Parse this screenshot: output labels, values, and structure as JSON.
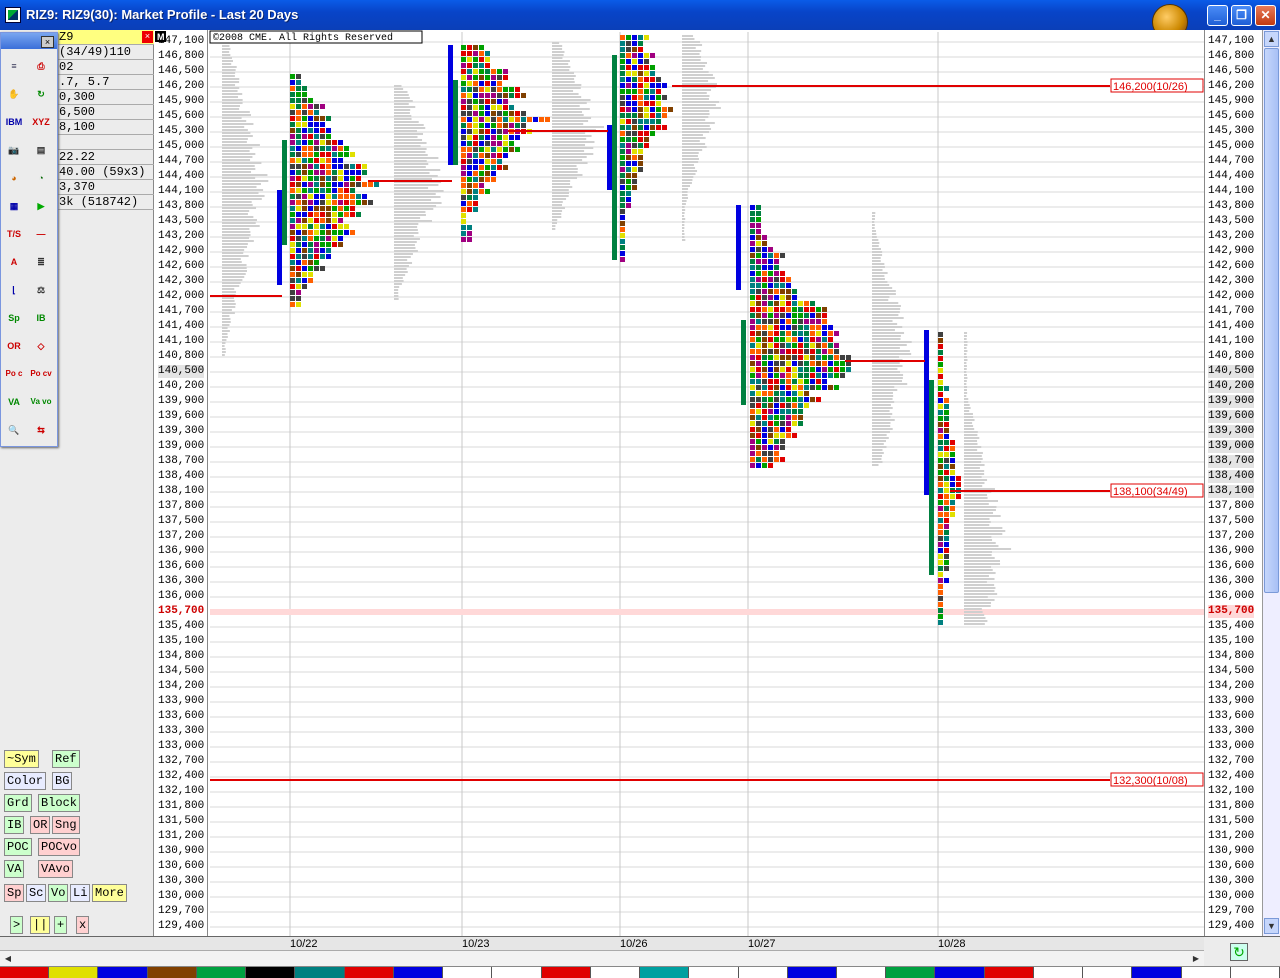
{
  "window": {
    "title": "RIZ9: RIZ9(30): Market Profile - Last 20 Days",
    "buttons": [
      "minimize",
      "maximize",
      "close"
    ]
  },
  "chart": {
    "copyright": "©2008 CME. All Rights Reserved",
    "marker_m": "M",
    "y_axis": {
      "step": 300,
      "max": 147100,
      "min": 129400,
      "labels": [
        "147,100",
        "146,800",
        "146,500",
        "146,200",
        "145,900",
        "145,600",
        "145,300",
        "145,000",
        "144,700",
        "144,400",
        "144,100",
        "143,800",
        "143,500",
        "143,200",
        "142,900",
        "142,600",
        "142,300",
        "142,000",
        "141,700",
        "141,400",
        "141,100",
        "140,800",
        "140,500",
        "140,200",
        "139,900",
        "139,600",
        "139,300",
        "139,000",
        "138,700",
        "138,400",
        "138,100",
        "137,800",
        "137,500",
        "137,200",
        "136,900",
        "136,600",
        "136,300",
        "136,000",
        "135,700",
        "135,400",
        "135,100",
        "134,800",
        "134,500",
        "134,200",
        "133,900",
        "133,600",
        "133,300",
        "133,000",
        "132,700",
        "132,400",
        "132,100",
        "131,800",
        "131,500",
        "131,200",
        "130,900",
        "130,600",
        "130,300",
        "130,000",
        "129,700",
        "129,400"
      ],
      "current_price": "135,700"
    },
    "x_axis": [
      "10/22",
      "10/23",
      "10/26",
      "10/27",
      "10/28"
    ],
    "level_lines": [
      {
        "label": "146,200(10/26)",
        "color": "#e00000"
      },
      {
        "label": "138,100(34/49)",
        "color": "#e00000"
      },
      {
        "label": "132,300(10/08)",
        "color": "#e00000"
      }
    ],
    "tpo_colors": [
      "#e00000",
      "#0000e0",
      "#e0e000",
      "#008040",
      "#804000",
      "#a00080",
      "#008080",
      "#ff6000",
      "#404040",
      "#00a000"
    ]
  },
  "info_panel": {
    "symbol": "Z9",
    "rows": [
      "(34/49)110",
      "02",
      ".7, 5.7",
      "0,300",
      "6,500",
      "8,100",
      "",
      "22.22",
      "40.00 (59x3)",
      "3,370",
      "3k (518742)"
    ]
  },
  "tool_palette": {
    "close": "×",
    "icons": [
      {
        "name": "bars-icon",
        "glyph": "≡",
        "color": "#335"
      },
      {
        "name": "printer-icon",
        "glyph": "⎙",
        "color": "#c00"
      },
      {
        "name": "hand-icon",
        "glyph": "✋",
        "color": "#333"
      },
      {
        "name": "refresh-icon",
        "glyph": "↻",
        "color": "#080"
      },
      {
        "name": "ibm-icon",
        "glyph": "IBM",
        "color": "#00a"
      },
      {
        "name": "xyz-icon",
        "glyph": "XYZ",
        "color": "#c00"
      },
      {
        "name": "camera-icon",
        "glyph": "📷",
        "color": "#333"
      },
      {
        "name": "page-icon",
        "glyph": "▤",
        "color": "#333"
      },
      {
        "name": "pie1-icon",
        "glyph": "◕",
        "color": "#c60"
      },
      {
        "name": "pie2-icon",
        "glyph": "◔",
        "color": "#060"
      },
      {
        "name": "grid-icon",
        "glyph": "▦",
        "color": "#00a"
      },
      {
        "name": "play-icon",
        "glyph": "▶",
        "color": "#0a0"
      },
      {
        "name": "ts-icon",
        "glyph": "T/S",
        "color": "#c00"
      },
      {
        "name": "line-icon",
        "glyph": "—",
        "color": "#c00"
      },
      {
        "name": "text-a-icon",
        "glyph": "A",
        "color": "#c00"
      },
      {
        "name": "align-icon",
        "glyph": "≣",
        "color": "#333"
      },
      {
        "name": "chart-icon",
        "glyph": "⌊",
        "color": "#00a"
      },
      {
        "name": "scale-icon",
        "glyph": "⚖",
        "color": "#333"
      },
      {
        "name": "sp-icon",
        "glyph": "Sp",
        "color": "#080"
      },
      {
        "name": "ib-icon",
        "glyph": "IB",
        "color": "#080"
      },
      {
        "name": "or-icon",
        "glyph": "OR",
        "color": "#c00"
      },
      {
        "name": "diamond-icon",
        "glyph": "◇",
        "color": "#c00"
      },
      {
        "name": "poc-c-icon",
        "glyph": "Po c",
        "color": "#c00"
      },
      {
        "name": "poc-cv-icon",
        "glyph": "Po cv",
        "color": "#c00"
      },
      {
        "name": "va-icon",
        "glyph": "VA",
        "color": "#080"
      },
      {
        "name": "va-vo-icon",
        "glyph": "Va vo",
        "color": "#080"
      },
      {
        "name": "zoom-icon",
        "glyph": "🔍",
        "color": "#00a"
      },
      {
        "name": "arrows-icon",
        "glyph": "⇆",
        "color": "#c00"
      }
    ]
  },
  "buttons": [
    {
      "label": "~Sym",
      "bg": "#ffff99"
    },
    {
      "label": "Ref",
      "bg": "#ccffcc"
    },
    {
      "label": "Color",
      "bg": "#e8ecff"
    },
    {
      "label": "BG",
      "bg": "#e8ecff"
    },
    {
      "label": "Grd",
      "bg": "#ccffcc"
    },
    {
      "label": "Block",
      "bg": "#ccffcc"
    },
    {
      "label": "IB",
      "bg": "#ccffcc"
    },
    {
      "label": "OR",
      "bg": "#ffd0d0"
    },
    {
      "label": "Sng",
      "bg": "#ffd0d0"
    },
    {
      "label": "POC",
      "bg": "#ccffcc"
    },
    {
      "label": "POCvo",
      "bg": "#ffd0d0"
    },
    {
      "label": "VA",
      "bg": "#ccffcc"
    },
    {
      "label": "VAvo",
      "bg": "#ffd0d0"
    },
    {
      "label": "Sp",
      "bg": "#ffd0d0"
    },
    {
      "label": "Sc",
      "bg": "#e8ecff"
    },
    {
      "label": "Vo",
      "bg": "#ccffcc"
    },
    {
      "label": "Li",
      "bg": "#e8ecff"
    },
    {
      "label": "More",
      "bg": "#ffff99"
    },
    {
      "label": ">",
      "bg": "#ccffcc"
    },
    {
      "label": "||",
      "bg": "#ffff99"
    },
    {
      "label": "+",
      "bg": "#ccffcc"
    },
    {
      "label": "x",
      "bg": "#ffd0d0"
    }
  ],
  "color_bar": [
    "#e00000",
    "#e0e000",
    "#0000e0",
    "#804000",
    "#00a040",
    "#000000",
    "#008080",
    "#e00000",
    "#0000e0",
    "#ffffff",
    "#ffffff",
    "#e00000",
    "#ffffff",
    "#00a0a0",
    "#ffffff",
    "#ffffff",
    "#0000e0",
    "#ffffff",
    "#00a040",
    "#0000e0",
    "#e00000",
    "#ffffff",
    "#ffffff",
    "#0000e0",
    "#ffffff",
    "#ffffff"
  ]
}
